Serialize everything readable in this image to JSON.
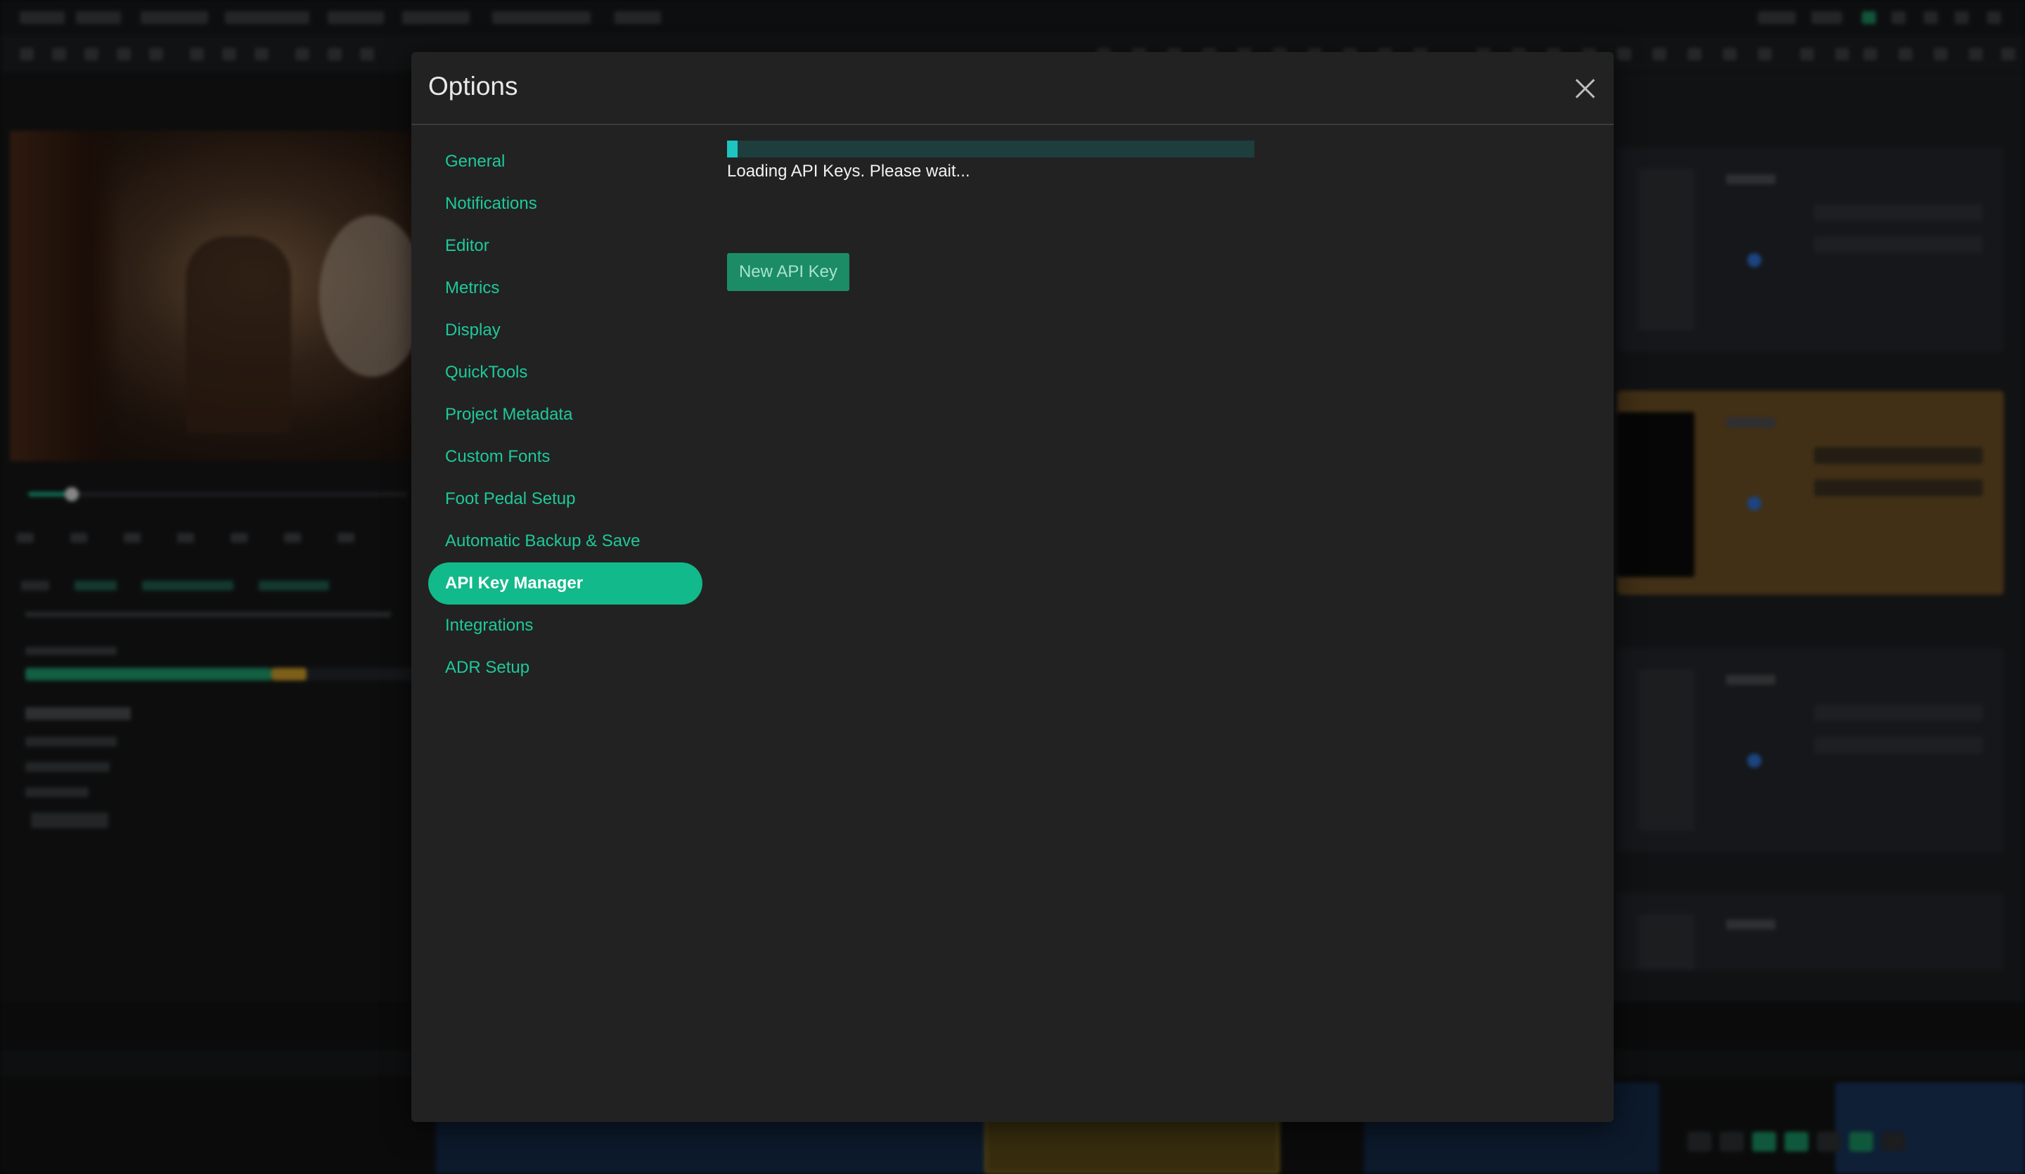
{
  "dialog": {
    "title": "Options",
    "close_label": "close"
  },
  "nav": {
    "items": [
      {
        "label": "General"
      },
      {
        "label": "Notifications"
      },
      {
        "label": "Editor"
      },
      {
        "label": "Metrics"
      },
      {
        "label": "Display"
      },
      {
        "label": "QuickTools"
      },
      {
        "label": "Project Metadata"
      },
      {
        "label": "Custom Fonts"
      },
      {
        "label": "Foot Pedal Setup"
      },
      {
        "label": "Automatic Backup & Save"
      },
      {
        "label": "API Key Manager",
        "active": true
      },
      {
        "label": "Integrations"
      },
      {
        "label": "ADR Setup"
      }
    ]
  },
  "api_keys": {
    "progress": 0.02,
    "loading_text": "Loading API Keys. Please wait...",
    "new_key_label": "New API Key"
  },
  "colors": {
    "accent": "#12b98a",
    "link": "#1ec99a",
    "progress_fill": "#1ec4c0",
    "progress_track": "#1e3e3e",
    "button_bg": "#1b8c66",
    "modal_bg": "#222222"
  },
  "icons": {
    "close": "close-icon"
  }
}
